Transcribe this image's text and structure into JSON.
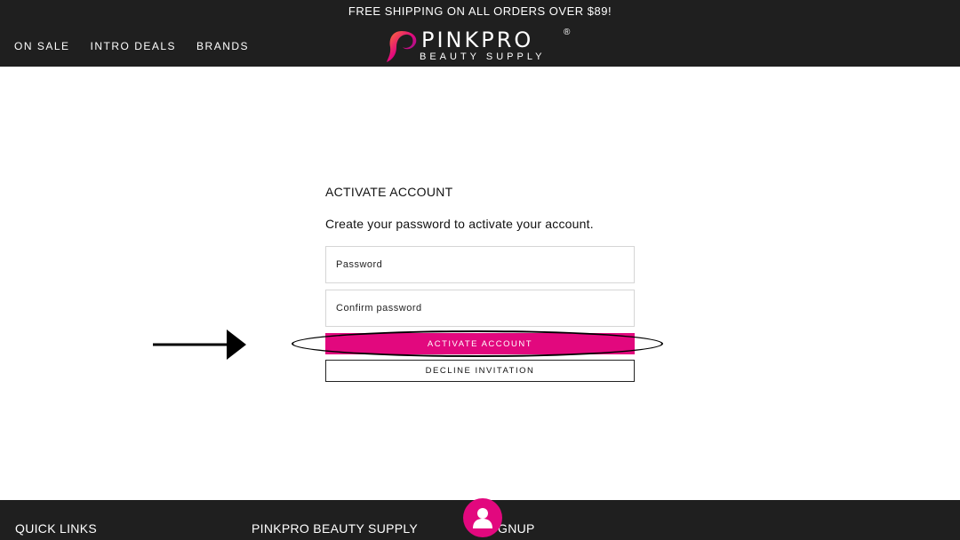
{
  "header": {
    "announcement": "FREE SHIPPING ON ALL ORDERS OVER $89!",
    "nav": [
      {
        "label": "ON SALE"
      },
      {
        "label": "INTRO DEALS"
      },
      {
        "label": "BRANDS"
      }
    ],
    "logo": {
      "main": "PINKPRO",
      "registered": "®",
      "sub": "BEAUTY SUPPLY"
    }
  },
  "form": {
    "title": "ACTIVATE ACCOUNT",
    "subtitle": "Create your password to activate your account.",
    "password_placeholder": "Password",
    "confirm_placeholder": "Confirm password",
    "activate_label": "ACTIVATE ACCOUNT",
    "decline_label": "DECLINE INVITATION"
  },
  "footer": {
    "quick_links": "QUICK LINKS",
    "brand": "PINKPRO BEAUTY SUPPLY",
    "signup": "GNUP"
  },
  "icons": {
    "account": "user-icon",
    "logo_mark": "hair-silhouette-icon"
  },
  "colors": {
    "brand_pink": "#e2087e",
    "header_bg": "#1f1f1f"
  }
}
